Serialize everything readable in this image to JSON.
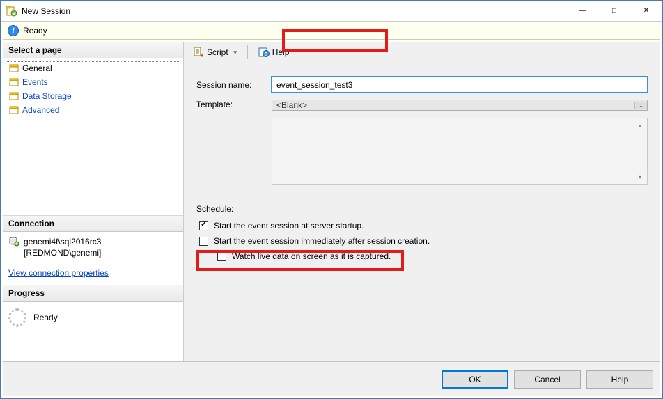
{
  "window": {
    "title": "New Session"
  },
  "readyStrip": {
    "text": "Ready"
  },
  "sidebar": {
    "selectPageHeader": "Select a page",
    "pages": [
      {
        "label": "General"
      },
      {
        "label": "Events"
      },
      {
        "label": "Data Storage"
      },
      {
        "label": "Advanced"
      }
    ],
    "connectionHeader": "Connection",
    "connection": {
      "line1": "genemi4f\\sql2016rc3",
      "line2": "[REDMOND\\genemi]"
    },
    "viewConnectionProps": "View connection properties",
    "progressHeader": "Progress",
    "progressText": "Ready"
  },
  "toolbar": {
    "script": "Script",
    "help": "Help"
  },
  "form": {
    "sessionNameLabel": "Session name:",
    "sessionNameValue": "event_session_test3",
    "templateLabel": "Template:",
    "templateValue": "<Blank>",
    "scheduleLabel": "Schedule:",
    "opt1": "Start the event session at server startup.",
    "opt2": "Start the event session immediately after session creation.",
    "opt3": "Watch live data on screen as it is captured."
  },
  "footer": {
    "ok": "OK",
    "cancel": "Cancel",
    "help": "Help"
  }
}
